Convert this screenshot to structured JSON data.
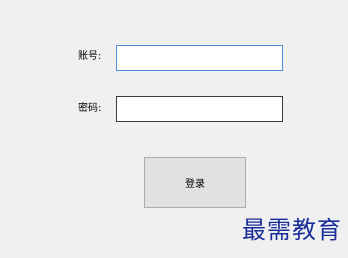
{
  "login_form": {
    "account_label": "账号:",
    "account_value": "",
    "password_label": "密码:",
    "password_value": "",
    "login_button_label": "登录"
  },
  "watermark": {
    "text": "最需教育",
    "color": "#1a2e9a"
  },
  "colors": {
    "background": "#f0f0f0",
    "focused_field_border": "#4a90d9",
    "button_background": "#e1e1e1"
  }
}
